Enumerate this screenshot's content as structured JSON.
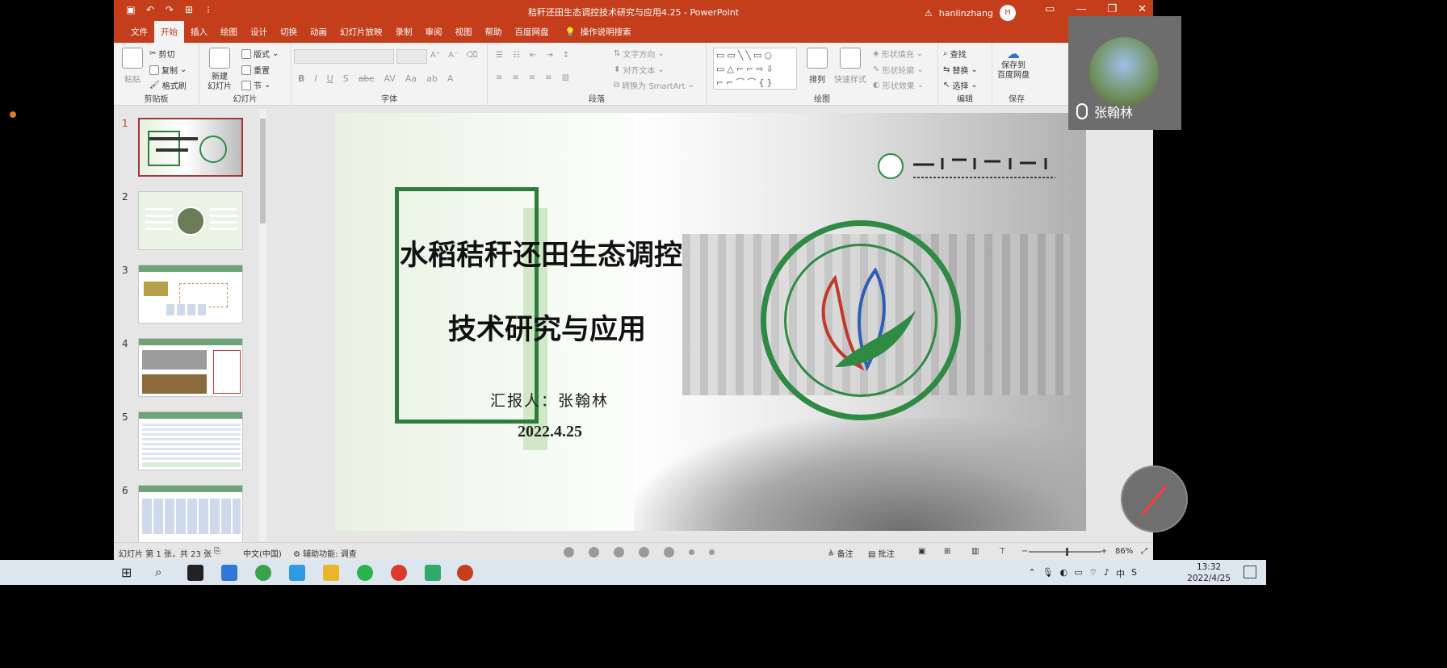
{
  "window": {
    "title": "秸秆还田生态调控技术研究与应用4.25 - PowerPoint",
    "user": "hanlinzhang",
    "user_initial": "H"
  },
  "tabs": [
    "文件",
    "开始",
    "插入",
    "绘图",
    "设计",
    "切换",
    "动画",
    "幻灯片放映",
    "录制",
    "审阅",
    "视图",
    "帮助",
    "百度网盘"
  ],
  "active_tab": "开始",
  "tell_me": "操作说明搜索",
  "ribbon": {
    "clipboard": {
      "label": "剪贴板",
      "paste": "粘贴",
      "cut": "剪切",
      "copy": "复制",
      "format_painter": "格式刷"
    },
    "slides": {
      "label": "幻灯片",
      "new_slide": "新建\n幻灯片",
      "layout": "版式",
      "reset": "重置",
      "section": "节"
    },
    "font": {
      "label": "字体"
    },
    "paragraph": {
      "label": "段落",
      "text_direction": "文字方向",
      "align_text": "对齐文本",
      "smartart": "转换为 SmartArt"
    },
    "drawing": {
      "label": "绘图",
      "arrange": "排列",
      "quick_styles": "快速样式",
      "shape_fill": "形状填充",
      "shape_outline": "形状轮廓",
      "shape_effects": "形状效果"
    },
    "editing": {
      "label": "编辑",
      "find": "查找",
      "replace": "替换",
      "select": "选择"
    },
    "save": {
      "label": "保存",
      "save_baidu": "保存到\n百度网盘"
    }
  },
  "thumbnails": [
    {
      "num": "1",
      "selected": true
    },
    {
      "num": "2",
      "selected": false
    },
    {
      "num": "3",
      "selected": false
    },
    {
      "num": "4",
      "selected": false
    },
    {
      "num": "5",
      "selected": false
    },
    {
      "num": "6",
      "selected": false
    }
  ],
  "slide": {
    "title_line1": "水稻秸秆还田生态调控",
    "title_line2": "技术研究与应用",
    "reporter": "汇报人：张翰林",
    "date": "2022.4.25"
  },
  "statusbar": {
    "slide_count": "幻灯片 第 1 张，共 23 张",
    "language": "中文(中国)",
    "accessibility": "辅助功能: 调查",
    "notes": "备注",
    "comments": "批注",
    "zoom_minus": "−",
    "zoom_plus": "+",
    "zoom": "86%"
  },
  "taskbar": {
    "time": "13:32",
    "date": "2022/4/25",
    "ime": "中"
  },
  "video_call": {
    "name": "张翰林"
  },
  "colors": {
    "titlebar": "#c43e1c",
    "accent_green": "#2e7d3b",
    "taskbar": "#dde6ef"
  }
}
